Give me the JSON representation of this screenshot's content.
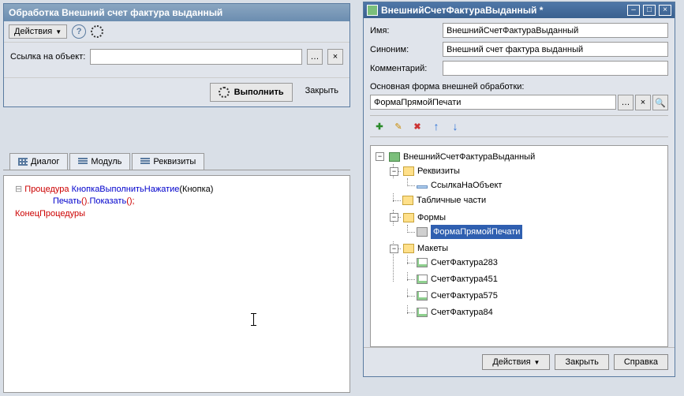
{
  "proc": {
    "title": "Обработка  Внешний счет фактура выданный",
    "actions_label": "Действия",
    "ref_label": "Ссылка на объект:",
    "ref_value": "",
    "exec_label": "Выполнить",
    "close_label": "Закрыть"
  },
  "tabs": {
    "dialog": "Диалог",
    "module": "Модуль",
    "requisites": "Реквизиты"
  },
  "code": {
    "l1a": "Процедура",
    "l1b": "КнопкаВыполнитьНажатие",
    "l1c": "(Кнопка)",
    "l2a": "Печать",
    "l2b": "().",
    "l2c": "Показать",
    "l2d": "();",
    "l3": "КонецПроцедуры"
  },
  "prop": {
    "title": "ВнешнийСчетФактураВыданный *",
    "name_label": "Имя:",
    "name_value": "ВнешнийСчетФактураВыданный",
    "syn_label": "Синоним:",
    "syn_value": "Внешний счет фактура выданный",
    "comment_label": "Комментарий:",
    "comment_value": "",
    "mainform_label": "Основная форма внешней обработки:",
    "mainform_value": "ФормаПрямойПечати",
    "footer_actions": "Действия",
    "footer_close": "Закрыть",
    "footer_help": "Справка"
  },
  "tree": {
    "root": "ВнешнийСчетФактураВыданный",
    "requisites": "Реквизиты",
    "reflink": "СсылкаНаОбъект",
    "tabparts": "Табличные части",
    "forms": "Формы",
    "form1": "ФормаПрямойПечати",
    "layouts": "Макеты",
    "l1": "СчетФактура283",
    "l2": "СчетФактура451",
    "l3": "СчетФактура575",
    "l4": "СчетФактура84"
  }
}
